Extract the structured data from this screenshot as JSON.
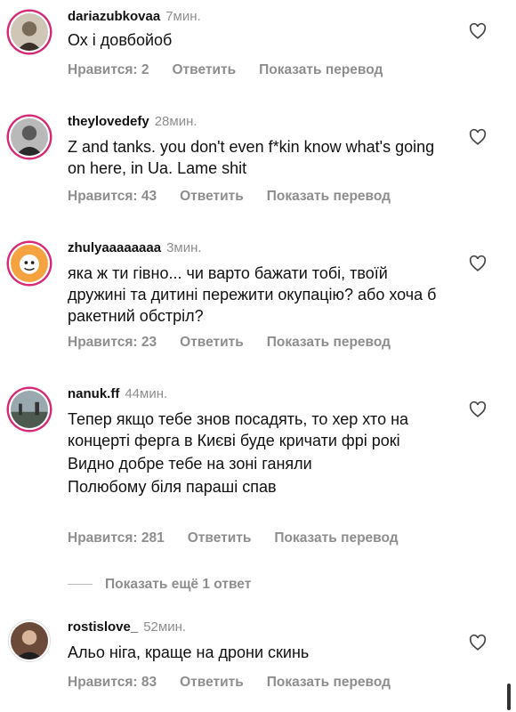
{
  "comments": [
    {
      "username": "dariazubkovaa",
      "time": "7мин.",
      "lines": [
        "Ох і довбойоб"
      ],
      "likes": "Нравится: 2",
      "reply": "Ответить",
      "translate": "Показать перевод",
      "avatar_icon": "avatar-photo"
    },
    {
      "username": "theylovedefy",
      "time": "28мин.",
      "lines": [
        "Z and tanks. you don't even f*kin know what's going on here, in Ua. Lame shit"
      ],
      "likes": "Нравится: 43",
      "reply": "Ответить",
      "translate": "Показать перевод",
      "avatar_icon": "avatar-photo"
    },
    {
      "username": "zhulyaaaaaaaa",
      "time": "3мин.",
      "lines": [
        "яка ж ти гівно... чи варто бажати тобі, твоїй дружині та дитині пережити окупацію? або хоча б ракетний обстріл?"
      ],
      "likes": "Нравится: 23",
      "reply": "Ответить",
      "translate": "Показать перевод",
      "avatar_icon": "avatar-illustration"
    },
    {
      "username": "nanuk.ff",
      "time": "44мин.",
      "lines": [
        "Тепер якщо тебе знов посадять, то хер хто на концерті ферга в Києві буде кричати фрі рокі",
        "Видно добре тебе на зоні ганяли",
        "Полюбому біля параші спав"
      ],
      "likes": "Нравится: 281",
      "reply": "Ответить",
      "translate": "Показать перевод",
      "avatar_icon": "avatar-landscape"
    },
    {
      "username": "rostislove_",
      "time": "52мин.",
      "lines": [
        "Альо ніга, краще на дрони скинь"
      ],
      "likes": "Нравится: 83",
      "reply": "Ответить",
      "translate": "Показать перевод",
      "avatar_icon": "avatar-photo"
    }
  ],
  "show_more_replies": "Показать ещё 1 ответ",
  "colors": {
    "story_ring": "#d62976",
    "secondary_text": "#8e8e8e",
    "primary_text": "#111111"
  }
}
